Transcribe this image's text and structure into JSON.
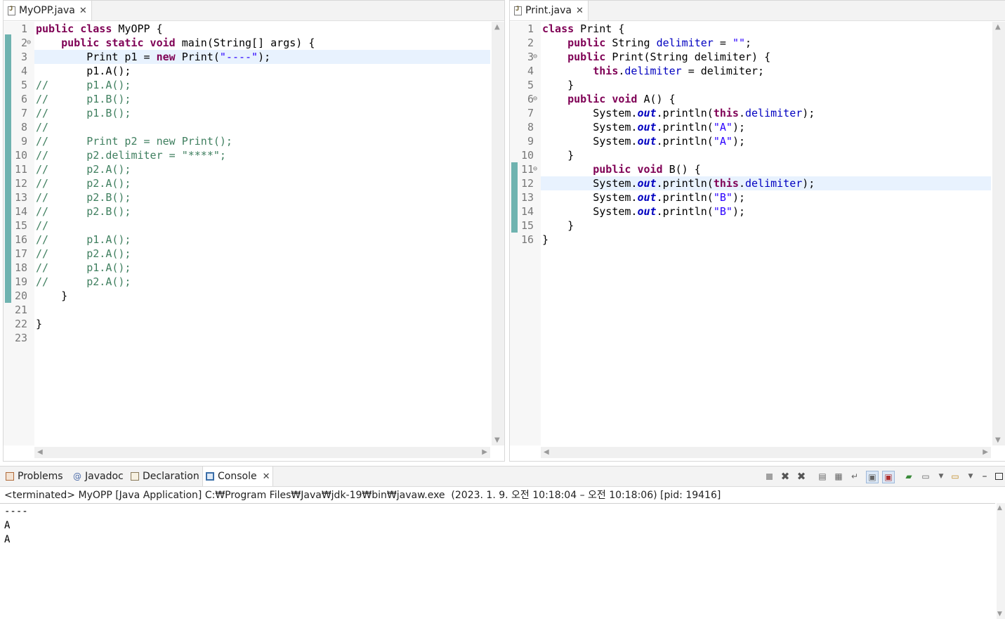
{
  "left_editor": {
    "tab_label": "MyOPP.java",
    "close_glyph": "✕",
    "current_line": 3,
    "lines": [
      {
        "n": "1",
        "html": "<span class=\"kw\">public class</span> MyOPP {"
      },
      {
        "n": "2",
        "fold": "⊖",
        "html": "    <span class=\"kw\">public static void</span> main(String[] args) {"
      },
      {
        "n": "3",
        "html": "        Print p1 = <span class=\"kw\">new</span> Print(<span class=\"str\">\"----\"</span>);"
      },
      {
        "n": "4",
        "html": "        p1.A();"
      },
      {
        "n": "5",
        "html": "<span class=\"cm\">//      p1.A();</span>"
      },
      {
        "n": "6",
        "html": "<span class=\"cm\">//      p1.B();</span>"
      },
      {
        "n": "7",
        "html": "<span class=\"cm\">//      p1.B();</span>"
      },
      {
        "n": "8",
        "html": "<span class=\"cm\">//</span>"
      },
      {
        "n": "9",
        "html": "<span class=\"cm\">//      Print p2 = new Print();</span>"
      },
      {
        "n": "10",
        "html": "<span class=\"cm\">//      p2.delimiter = \"****\";</span>"
      },
      {
        "n": "11",
        "html": "<span class=\"cm\">//      p2.A();</span>"
      },
      {
        "n": "12",
        "html": "<span class=\"cm\">//      p2.A();</span>"
      },
      {
        "n": "13",
        "html": "<span class=\"cm\">//      p2.B();</span>"
      },
      {
        "n": "14",
        "html": "<span class=\"cm\">//      p2.B();</span>"
      },
      {
        "n": "15",
        "html": "<span class=\"cm\">//</span>"
      },
      {
        "n": "16",
        "html": "<span class=\"cm\">//      p1.A();</span>"
      },
      {
        "n": "17",
        "html": "<span class=\"cm\">//      p2.A();</span>"
      },
      {
        "n": "18",
        "html": "<span class=\"cm\">//      p1.A();</span>"
      },
      {
        "n": "19",
        "html": "<span class=\"cm\">//      p2.A();</span>"
      },
      {
        "n": "20",
        "html": "    }"
      },
      {
        "n": "21",
        "html": ""
      },
      {
        "n": "22",
        "html": "}"
      },
      {
        "n": "23",
        "html": ""
      }
    ]
  },
  "right_editor": {
    "tab_label": "Print.java",
    "close_glyph": "✕",
    "current_line": 12,
    "lines": [
      {
        "n": "1",
        "html": "<span class=\"kw\">class</span> Print {"
      },
      {
        "n": "2",
        "html": "    <span class=\"kw\">public</span> String <span class=\"fld\">delimiter</span> = <span class=\"str\">\"\"</span>;"
      },
      {
        "n": "3",
        "fold": "⊖",
        "html": "    <span class=\"kw\">public</span> Print(String delimiter) {"
      },
      {
        "n": "4",
        "html": "        <span class=\"kw\">this</span>.<span class=\"fld\">delimiter</span> = delimiter;"
      },
      {
        "n": "5",
        "html": "    }"
      },
      {
        "n": "6",
        "fold": "⊖",
        "html": "    <span class=\"kw\">public void</span> A() {"
      },
      {
        "n": "7",
        "html": "        System.<span class=\"sfld\">out</span>.println(<span class=\"kw\">this</span>.<span class=\"fld\">delimiter</span>);"
      },
      {
        "n": "8",
        "html": "        System.<span class=\"sfld\">out</span>.println(<span class=\"str\">\"A\"</span>);"
      },
      {
        "n": "9",
        "html": "        System.<span class=\"sfld\">out</span>.println(<span class=\"str\">\"A\"</span>);"
      },
      {
        "n": "10",
        "html": "    }"
      },
      {
        "n": "11",
        "fold": "⊖",
        "html": "        <span class=\"kw\">public void</span> B() {"
      },
      {
        "n": "12",
        "html": "        System.<span class=\"sfld\">out</span>.println(<span class=\"kw\">this</span>.<span class=\"fld\">delimiter</span>);"
      },
      {
        "n": "13",
        "html": "        System.<span class=\"sfld\">out</span>.println(<span class=\"str\">\"B\"</span>);"
      },
      {
        "n": "14",
        "html": "        System.<span class=\"sfld\">out</span>.println(<span class=\"str\">\"B\"</span>);"
      },
      {
        "n": "15",
        "html": "    }"
      },
      {
        "n": "16",
        "html": "}"
      }
    ]
  },
  "console_view": {
    "tabs": [
      {
        "label": "Problems",
        "icon": "problems-icon"
      },
      {
        "label": "Javadoc",
        "icon": "javadoc-icon"
      },
      {
        "label": "Declaration",
        "icon": "declaration-icon"
      },
      {
        "label": "Console",
        "icon": "console-icon",
        "active": true
      }
    ],
    "close_glyph": "✕",
    "status_line": "<terminated> MyOPP [Java Application] C:₩Program Files₩Java₩jdk-19₩bin₩javaw.exe  (2023. 1. 9. 오전 10:18:04 – 오전 10:18:06) [pid: 19416]",
    "output": [
      "----",
      "A",
      "A"
    ]
  },
  "colors": {
    "keyword": "#7f0055",
    "string": "#2a00ff",
    "field": "#0000c0",
    "comment": "#3f7f5f",
    "current_line": "#e8f2fe",
    "quickdiff": "#6fb3b0"
  }
}
